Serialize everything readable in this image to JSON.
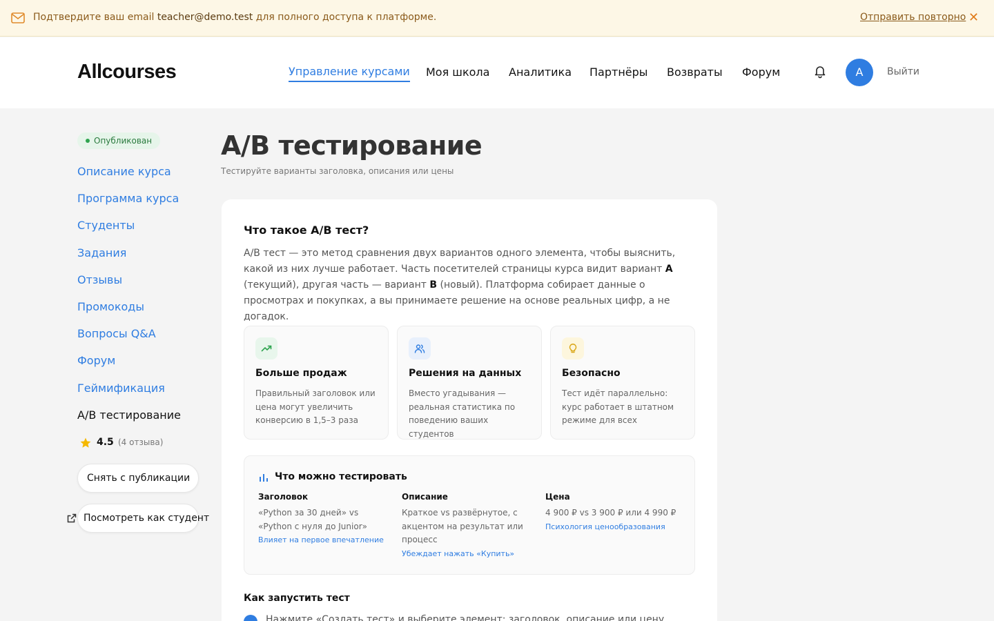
{
  "banner": {
    "message_before": "Подтвердите ваш email ",
    "email": "teacher@demo.test",
    "message_after": " для полного доступа к платформе.",
    "resend_label": "Отправить повторно",
    "close_symbol": "✕"
  },
  "header": {
    "logo": "Allcourses",
    "nav": [
      {
        "label": "Управление курсами",
        "active": true
      },
      {
        "label": "Моя школа"
      },
      {
        "label": "Аналитика"
      },
      {
        "label": "Партнёры"
      },
      {
        "label": "Возвраты"
      },
      {
        "label": "Форум"
      }
    ],
    "avatar_letter": "A",
    "logout_label": "Выйти"
  },
  "sidebar": {
    "status_badge": "Опубликован",
    "items": [
      {
        "label": "Описание курса"
      },
      {
        "label": "Программа курса"
      },
      {
        "label": "Студенты"
      },
      {
        "label": "Задания"
      },
      {
        "label": "Отзывы"
      },
      {
        "label": "Промокоды"
      },
      {
        "label": "Вопросы Q&A"
      },
      {
        "label": "Форум"
      },
      {
        "label": "Геймификация"
      },
      {
        "label": "A/B тестирование",
        "current": true
      }
    ],
    "rating": {
      "value": "4.5",
      "count": "(4 отзыва)"
    },
    "unpublish_label": "Снять с публикации",
    "view_as_student_label": "Посмотреть как студент"
  },
  "main": {
    "title": "A/B тестирование",
    "subtitle": "Тестируйте варианты заголовка, описания или цены",
    "card": {
      "heading": "Что такое A/B тест?",
      "intro": {
        "part1": "A/B тест — это метод сравнения двух вариантов одного элемента, чтобы выяснить, какой из них лучше работает. Часть посетителей страницы курса видит вариант ",
        "a": "A",
        "part2": " (текущий), другая часть — вариант ",
        "b": "B",
        "part3": " (новый). Платформа собирает данные о просмотрах и покупках, а вы принимаете решение на основе реальных цифр, а не догадок."
      },
      "features": [
        {
          "title": "Больше продаж",
          "desc": "Правильный заголовок или цена могут увеличить конверсию в 1,5–3 раза",
          "icon": "trending-up-icon",
          "color": "#2ea44f",
          "bg": "#e8f6ec"
        },
        {
          "title": "Решения на данных",
          "desc": "Вместо угадывания — реальная статистика по поведению ваших студентов",
          "icon": "users-icon",
          "color": "#2f7de1",
          "bg": "#e8f0fc"
        },
        {
          "title": "Безопасно",
          "desc": "Тест идёт параллельно: курс работает в штатном режиме для всех",
          "icon": "lightbulb-icon",
          "color": "#d9a514",
          "bg": "#fdf6dd"
        }
      ],
      "test_box": {
        "heading": "Что можно тестировать",
        "columns": [
          {
            "title": "Заголовок",
            "desc": "«Python за 30 дней» vs «Python с нуля до Junior»",
            "link": "Влияет на первое впечатление"
          },
          {
            "title": "Описание",
            "desc": "Краткое vs развёрнутое, с акцентом на результат или процесс",
            "link": "Убеждает нажать «Купить»"
          },
          {
            "title": "Цена",
            "desc": "4 900 ₽ vs 3 900 ₽ или 4 990 ₽",
            "link": "Психология ценообразования"
          }
        ]
      },
      "how_heading": "Как запустить тест",
      "step1": "Нажмите «Создать тест» и выберите элемент: заголовок, описание или цену"
    }
  }
}
